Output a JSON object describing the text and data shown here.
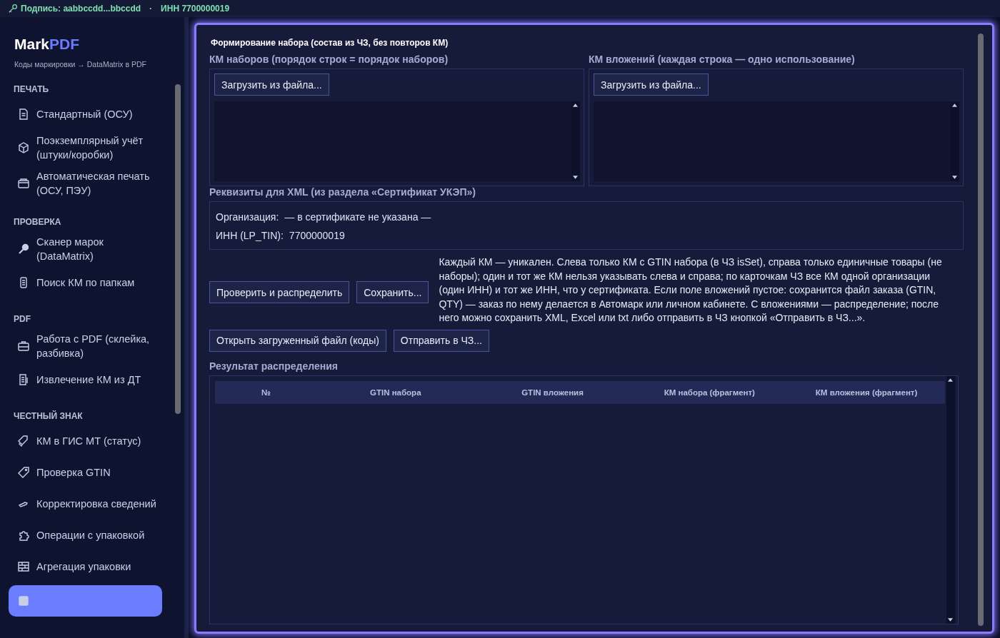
{
  "status_bar": {
    "signature": "Подпись: aabbccdd...bbccdd",
    "separator": "·",
    "inn": "ИНН 7700000019"
  },
  "sidebar": {
    "logo_main": "Mark",
    "logo_accent": "PDF",
    "subtitle": "Коды маркировки → DataMatrix в PDF",
    "sections": [
      {
        "title": "ПЕЧАТЬ",
        "items": [
          {
            "label": "Стандартный (ОСУ)",
            "selected": false
          },
          {
            "label": "Поэкземплярный учёт (штуки/коробки)",
            "selected": false
          },
          {
            "label": "Автоматическая печать (ОСУ, ПЭУ)",
            "selected": false
          }
        ]
      },
      {
        "title": "ПРОВЕРКА",
        "items": [
          {
            "label": "Сканер марок (DataMatrix)",
            "selected": false
          },
          {
            "label": "Поиск КМ по папкам",
            "selected": false
          }
        ]
      },
      {
        "title": "PDF",
        "items": [
          {
            "label": "Работа с PDF (склейка, разбивка)",
            "selected": false
          },
          {
            "label": "Извлечение КМ из ДТ",
            "selected": false
          }
        ]
      },
      {
        "title": "ЧЕСТНЫЙ ЗНАК",
        "items": [
          {
            "label": "КМ в ГИС МТ (статус)",
            "selected": false
          },
          {
            "label": "Проверка GTIN",
            "selected": false
          },
          {
            "label": "Корректировка сведений",
            "selected": false
          },
          {
            "label": "Операции с упаковкой",
            "selected": false
          },
          {
            "label": "Агрегация упаковки",
            "selected": false
          },
          {
            "selected": true
          }
        ]
      }
    ]
  },
  "main": {
    "title": "Формирование набора (состав из ЧЗ, без повторов КМ)",
    "inputs": [
      {
        "label": "КМ наборов (порядок строк = порядок наборов)",
        "button": "Загрузить из файла..."
      },
      {
        "label": "КМ вложений (каждая строка — одно использование)",
        "button": "Загрузить из файла..."
      }
    ],
    "requisites": {
      "label": "Реквизиты для XML (из раздела «Сертификат УКЭП»)",
      "rows": [
        {
          "key": "Организация:",
          "value": "— в сертификате не указана —"
        },
        {
          "key": "ИНН (LP_TIN):",
          "value": "7700000019"
        }
      ]
    },
    "actions": [
      "Проверить и распределить",
      "Сохранить..."
    ],
    "help": "Каждый КМ — уникален. Слева только КМ с GTIN набора (в ЧЗ isSet), справа только единичные товары (не наборы); один и тот же КМ нельзя указывать слева и справа; по карточкам ЧЗ все КМ одной организации (один ИНН) и тот же ИНН, что у сертификата. Если поле вложений пустое: сохранится файл заказа (GTIN, QTY) — заказ по нему делается в Автомарк или личном кабинете. С вложениями — распределение; после него можно сохранить XML, Excel или txt либо отправить в ЧЗ кнопкой «Отправить в ЧЗ...».",
    "actions2": [
      "Открыть загруженный файл (коды)",
      "Отправить в ЧЗ..."
    ],
    "result": {
      "label": "Результат распределения",
      "columns": [
        "№",
        "GTIN набора",
        "GTIN вложения",
        "КМ набора (фрагмент)",
        "КМ вложения (фрагмент)"
      ]
    }
  }
}
